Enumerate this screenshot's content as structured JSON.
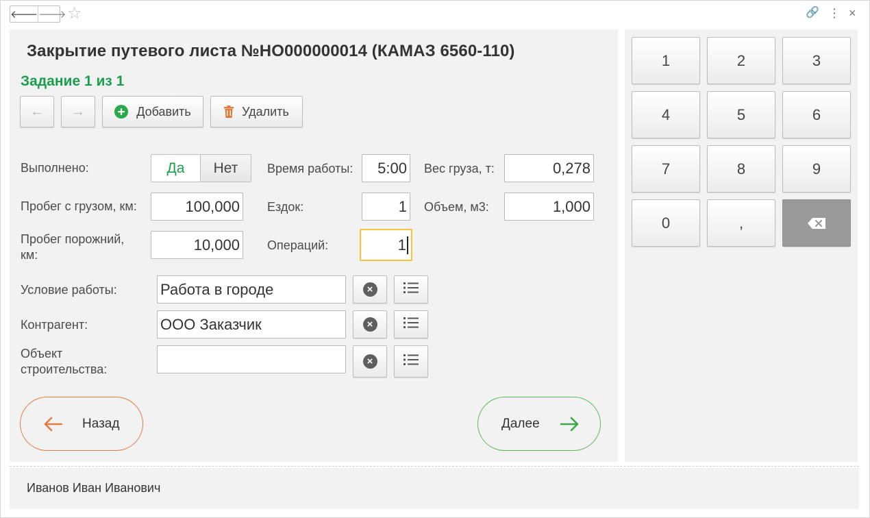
{
  "window": {
    "back_icon": "arrow-left-icon",
    "forward_icon": "arrow-right-icon",
    "favorite_icon": "star-icon",
    "link_icon": "link-icon",
    "menu_icon": "more-vertical-icon",
    "close_icon": "close-icon",
    "back_glyph": "🡐",
    "forward_glyph": "🡒",
    "star_glyph": "☆",
    "link_glyph": "🔗",
    "menu_glyph": "⋮",
    "close_glyph": "×"
  },
  "header": {
    "title": "Закрытие путевого листа №НО000000014 (КАМАЗ 6560-110)",
    "task": "Задание 1 из 1"
  },
  "toolbar": {
    "prev_glyph": "←",
    "next_glyph": "→",
    "add_label": "Добавить",
    "delete_label": "Удалить"
  },
  "form": {
    "done_label": "Выполнено:",
    "done_yes": "Да",
    "done_no": "Нет",
    "loaded_mileage_label": "Пробег с грузом, км:",
    "loaded_mileage_value": "100,000",
    "empty_mileage_label": "Пробег порожний, км:",
    "empty_mileage_value": "10,000",
    "work_time_label": "Время работы:",
    "work_time_value": "5:00",
    "trips_label": "Ездок:",
    "trips_value": "1",
    "operations_label": "Операций:",
    "operations_value": "1",
    "cargo_weight_label": "Вес груза, т:",
    "cargo_weight_value": "0,278",
    "volume_label": "Объем, м3:",
    "volume_value": "1,000",
    "work_condition_label": "Условие работы:",
    "work_condition_value": "Работа в городе",
    "counterparty_label": "Контрагент:",
    "counterparty_value": "ООО Заказчик",
    "construction_label": "Объект строительства:",
    "construction_value": ""
  },
  "nav": {
    "back_label": "Назад",
    "next_label": "Далее"
  },
  "keypad": {
    "keys": [
      "1",
      "2",
      "3",
      "4",
      "5",
      "6",
      "7",
      "8",
      "9",
      "0",
      ","
    ],
    "backspace_icon": "backspace-icon"
  },
  "footer": {
    "user": "Иванов Иван Иванович"
  },
  "colors": {
    "accent_green": "#1a9e4e",
    "back_orange": "#e57c44",
    "focus_yellow": "#f5c43a",
    "panel_bg": "#f2f2f2"
  }
}
